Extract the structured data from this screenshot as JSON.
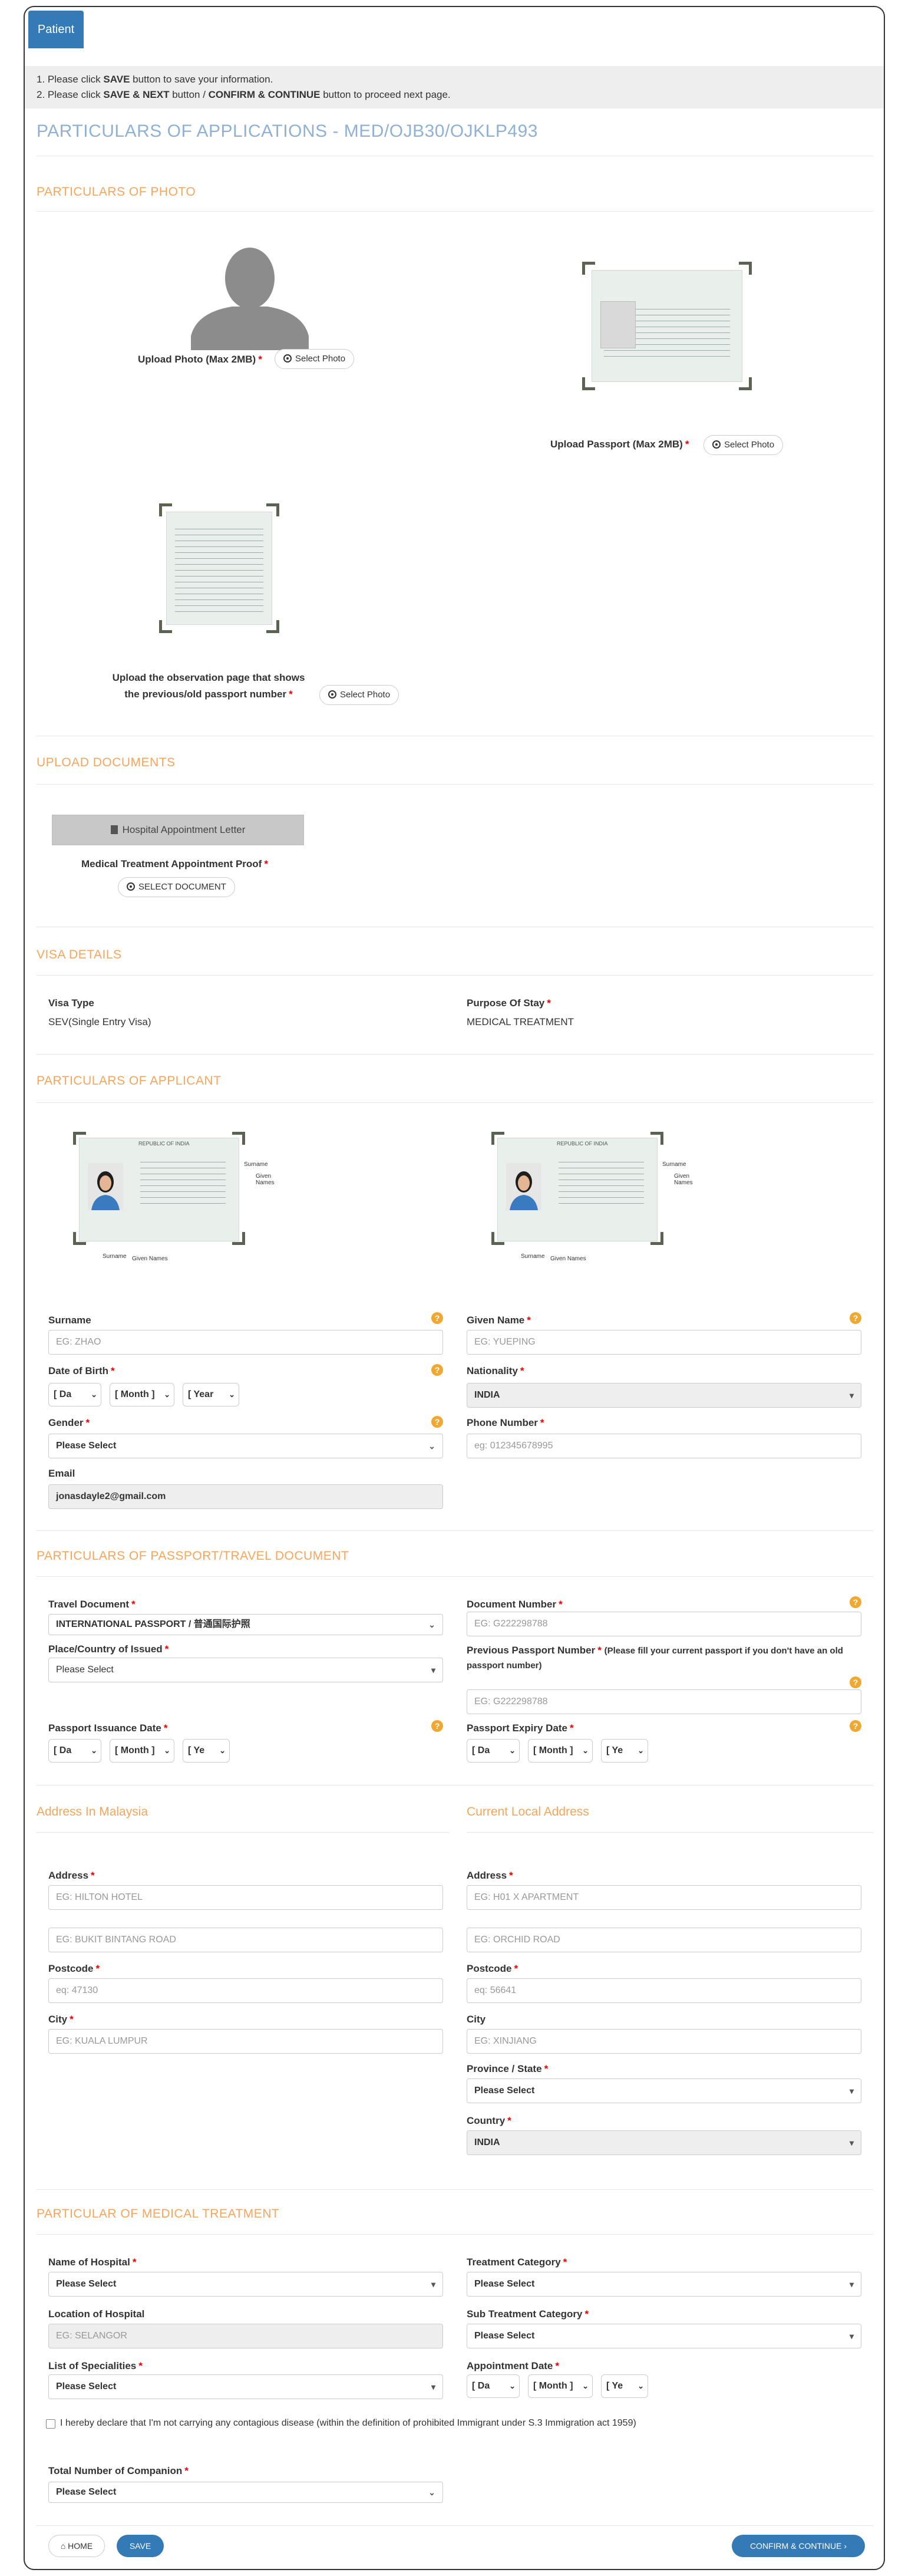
{
  "tab": {
    "label": "Patient"
  },
  "instructions": {
    "line1_pre": "1. Please click ",
    "line1_bold": "SAVE",
    "line1_post": " button to save your information.",
    "line2_pre": "2. Please click ",
    "line2_bold1": "SAVE & NEXT",
    "line2_mid": " button / ",
    "line2_bold2": "CONFIRM & CONTINUE",
    "line2_post": " button to proceed next page."
  },
  "page_title": "PARTICULARS OF APPLICATIONS - MED/OJB30/OJKLP493",
  "photo": {
    "section": "PARTICULARS OF PHOTO",
    "upload_photo_label": "Upload Photo (Max 2MB)",
    "upload_passport_label": "Upload Passport (Max 2MB)",
    "observation_label_1": "Upload the observation page that shows",
    "observation_label_2": "the previous/old passport number",
    "select_photo": "Select Photo"
  },
  "documents": {
    "section": "UPLOAD DOCUMENTS",
    "hospital_letter": "Hospital Appointment Letter",
    "proof_label": "Medical Treatment Appointment Proof",
    "select_document": "SELECT DOCUMENT"
  },
  "visa": {
    "section": "VISA DETAILS",
    "type_label": "Visa Type",
    "type_value": "SEV(Single Entry Visa)",
    "purpose_label": "Purpose Of Stay",
    "purpose_value": "MEDICAL TREATMENT"
  },
  "applicant": {
    "section": "PARTICULARS OF APPLICANT",
    "surname_label": "Surname",
    "surname_placeholder": "EG: ZHAO",
    "given_label": "Given Name",
    "given_placeholder": "EG: YUEPING",
    "dob_label": "Date of Birth",
    "dob_day": "[ Da",
    "dob_month": "[ Month ]",
    "dob_year": "[ Year",
    "nationality_label": "Nationality",
    "nationality_value": "INDIA",
    "gender_label": "Gender",
    "gender_value": "Please Select",
    "phone_label": "Phone Number",
    "phone_placeholder": "eg: 012345678995",
    "email_label": "Email",
    "email_value": "jonasdayle2@gmail.com",
    "sample_republic": "REPUBLIC OF INDIA",
    "sample_surname": "Surname",
    "sample_given": "Given Names"
  },
  "passport": {
    "section": "PARTICULARS OF PASSPORT/TRAVEL DOCUMENT",
    "travel_doc_label": "Travel Document",
    "travel_doc_value": "INTERNATIONAL PASSPORT / 普通国际护照",
    "doc_number_label": "Document Number",
    "doc_number_placeholder": "EG: G222298788",
    "place_label": "Place/Country of Issued",
    "place_value": "Please Select",
    "prev_label": "Previous Passport Number",
    "prev_note": "(Please fill your current passport if you don't have an old passport number)",
    "prev_placeholder": "EG: G222298788",
    "issue_label": "Passport Issuance Date",
    "expiry_label": "Passport Expiry Date",
    "day": "[ Da",
    "month": "[ Month ]",
    "year": "[ Ye"
  },
  "address_my": {
    "section": "Address In Malaysia",
    "address_label": "Address",
    "address1_placeholder": "EG: HILTON HOTEL",
    "address2_placeholder": "EG: BUKIT BINTANG ROAD",
    "postcode_label": "Postcode",
    "postcode_placeholder": "eq: 47130",
    "city_label": "City",
    "city_placeholder": "EG: KUALA LUMPUR"
  },
  "address_local": {
    "section": "Current Local Address",
    "address_label": "Address",
    "address1_placeholder": "EG: H01 X APARTMENT",
    "address2_placeholder": "EG: ORCHID ROAD",
    "postcode_label": "Postcode",
    "postcode_placeholder": "eq: 56641",
    "city_label": "City",
    "city_placeholder": "EG: XINJIANG",
    "province_label": "Province / State",
    "province_value": "Please Select",
    "country_label": "Country",
    "country_value": "INDIA"
  },
  "medical": {
    "section": "PARTICULAR OF MEDICAL TREATMENT",
    "hospital_label": "Name of Hospital",
    "hospital_value": "Please Select",
    "category_label": "Treatment Category",
    "category_value": "Please Select",
    "location_label": "Location of Hospital",
    "location_placeholder": "EG: SELANGOR",
    "subcategory_label": "Sub Treatment Category",
    "subcategory_value": "Please Select",
    "specialities_label": "List of Specialities",
    "specialities_value": "Please Select",
    "appointment_label": "Appointment Date",
    "declaration": "I hereby declare that I'm not carrying any contagious disease (within the definition of prohibited Immigrant under S.3 Immigration act 1959)",
    "companion_label": "Total Number of Companion",
    "companion_value": "Please Select"
  },
  "footer": {
    "home": "HOME",
    "save": "SAVE",
    "confirm": "CONFIRM & CONTINUE"
  }
}
